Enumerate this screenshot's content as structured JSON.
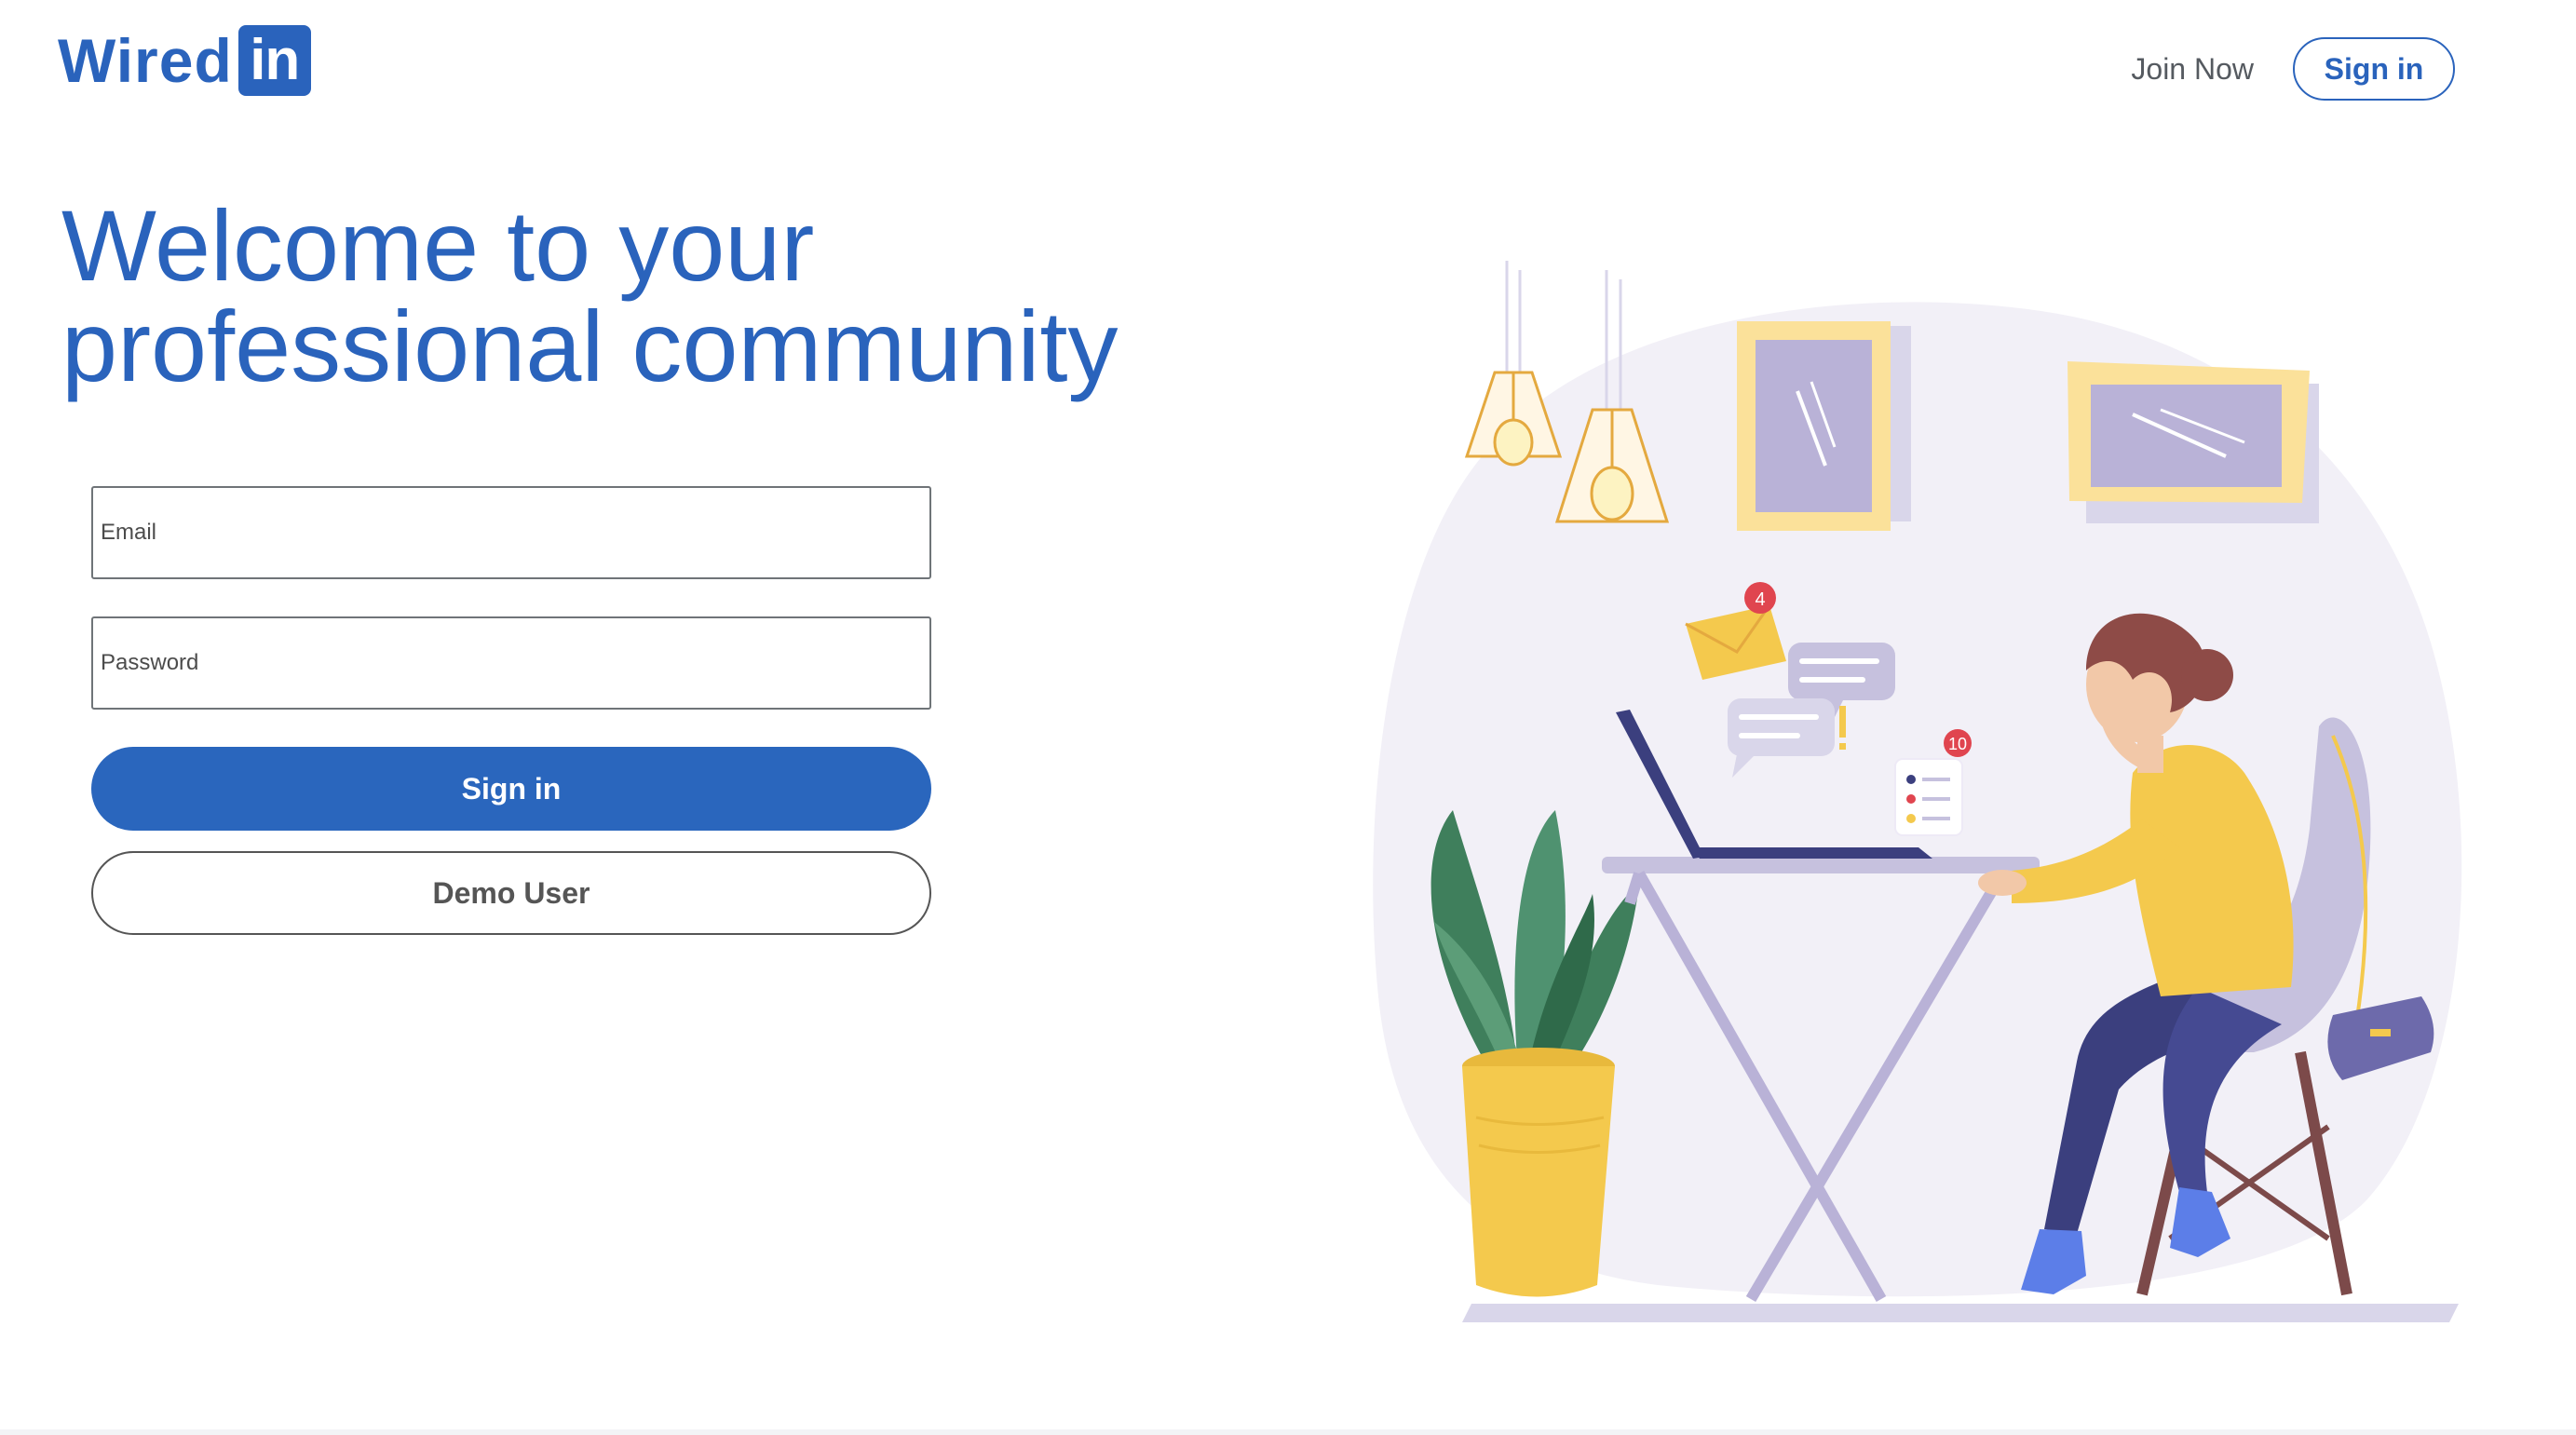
{
  "logo": {
    "word": "Wired",
    "box": "in"
  },
  "nav": {
    "join_now": "Join Now",
    "sign_in": "Sign in"
  },
  "headline": {
    "line1": "Welcome to your",
    "line2": "professional community"
  },
  "form": {
    "email_placeholder": "Email",
    "password_placeholder": "Password",
    "sign_in": "Sign in",
    "demo_user": "Demo User"
  },
  "illustration": {
    "mail_badge": "4",
    "list_badge": "10"
  },
  "colors": {
    "brand": "#2a63bc",
    "badge": "#e0454f",
    "yellow": "#f4c94d",
    "lavender": "#b9b2d7",
    "plant": "#3f7f5c"
  }
}
